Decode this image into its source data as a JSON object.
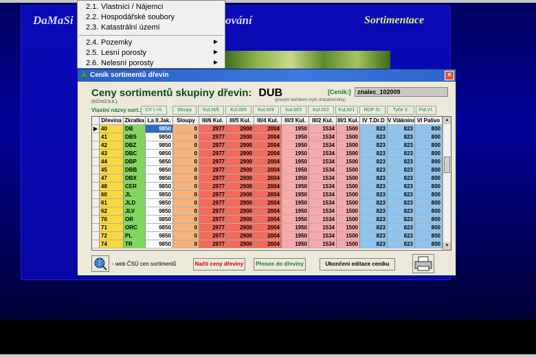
{
  "app": {
    "title": "DaMaSi",
    "title2": "ování",
    "section": "Sortimentace"
  },
  "menu": {
    "items": [
      {
        "num": "2.1.",
        "label": "Vlastníci / Nájemci",
        "submenu": false
      },
      {
        "num": "2.2.",
        "label": "Hospodářské soubory",
        "submenu": false
      },
      {
        "num": "2.3.",
        "label": "Katastrální území",
        "submenu": false
      },
      {
        "num": "2.4.",
        "label": "Pozemky",
        "submenu": true
      },
      {
        "num": "2.5.",
        "label": "Lesní porosty",
        "submenu": true
      },
      {
        "num": "2.6.",
        "label": "Nelesní porosty",
        "submenu": true
      }
    ]
  },
  "dialog": {
    "title": "Ceník sortimentů dřevin",
    "heading": "Ceny sortimentů skupiny dřevin:",
    "group_code": "DUB",
    "unit_note": "(Kč/m3 b.k.)",
    "hint": "(pravým tlačítkem myši charakteristiky)",
    "cenik_label": "[Cenik:]",
    "cenik_value": "znalec_102009",
    "names_label": "Vlastní názvy sort.:",
    "column_name_buttons": [
      "CV I.+II.",
      "Sloupy",
      "Kul.III/6",
      "Kul.III/5",
      "Kul.III/4",
      "Kul.III/3",
      "Kul.III/2",
      "Kul.III/1",
      "RDP IV.",
      "Tyče V.",
      "Pal.VI."
    ],
    "columns": [
      "",
      "Dřevina",
      "Zkratka",
      "La II.Jak.",
      "Sloupy",
      "III/6 Kul.",
      "III/5 Kul.",
      "III/4 Kul.",
      "III/3 Kul.",
      "III/2 Kul.",
      "III/1 Kul.",
      "IV T.Dr.D",
      "V Vláknina",
      "VI Palivo"
    ],
    "rows": [
      [
        "▶",
        "40",
        "DB",
        "9850",
        "0",
        "2977",
        "2900",
        "2004",
        "1950",
        "1534",
        "1500",
        "823",
        "823",
        "800"
      ],
      [
        "",
        "41",
        "DBS",
        "9850",
        "0",
        "2977",
        "2900",
        "2004",
        "1950",
        "1534",
        "1500",
        "823",
        "823",
        "800"
      ],
      [
        "",
        "42",
        "DBZ",
        "9850",
        "0",
        "2977",
        "2900",
        "2004",
        "1950",
        "1534",
        "1500",
        "823",
        "823",
        "800"
      ],
      [
        "",
        "43",
        "DBC",
        "9850",
        "0",
        "2977",
        "2900",
        "2004",
        "1950",
        "1534",
        "1500",
        "823",
        "823",
        "800"
      ],
      [
        "",
        "44",
        "DBP",
        "9850",
        "0",
        "2977",
        "2900",
        "2004",
        "1950",
        "1534",
        "1500",
        "823",
        "823",
        "800"
      ],
      [
        "",
        "45",
        "DBB",
        "9850",
        "0",
        "2977",
        "2900",
        "2004",
        "1950",
        "1534",
        "1500",
        "823",
        "823",
        "800"
      ],
      [
        "",
        "47",
        "DBX",
        "9850",
        "0",
        "2977",
        "2900",
        "2004",
        "1950",
        "1534",
        "1500",
        "823",
        "823",
        "800"
      ],
      [
        "",
        "48",
        "CER",
        "9850",
        "0",
        "2977",
        "2900",
        "2004",
        "1950",
        "1534",
        "1500",
        "823",
        "823",
        "800"
      ],
      [
        "",
        "60",
        "JL",
        "9850",
        "0",
        "2977",
        "2900",
        "2004",
        "1950",
        "1534",
        "1500",
        "823",
        "823",
        "800"
      ],
      [
        "",
        "61",
        "JLD",
        "9850",
        "0",
        "2977",
        "2900",
        "2004",
        "1950",
        "1534",
        "1500",
        "823",
        "823",
        "800"
      ],
      [
        "",
        "62",
        "JLV",
        "9850",
        "0",
        "2977",
        "2900",
        "2004",
        "1950",
        "1534",
        "1500",
        "823",
        "823",
        "800"
      ],
      [
        "",
        "70",
        "OR",
        "9850",
        "0",
        "2977",
        "2900",
        "2004",
        "1950",
        "1534",
        "1500",
        "823",
        "823",
        "800"
      ],
      [
        "",
        "71",
        "ORC",
        "9850",
        "0",
        "2977",
        "2900",
        "2004",
        "1950",
        "1534",
        "1500",
        "823",
        "823",
        "800"
      ],
      [
        "",
        "72",
        "PL",
        "9850",
        "0",
        "2977",
        "2900",
        "2004",
        "1950",
        "1534",
        "1500",
        "823",
        "823",
        "800"
      ],
      [
        "",
        "74",
        "TR",
        "9850",
        "0",
        "2977",
        "2900",
        "2004",
        "1950",
        "1534",
        "1500",
        "823",
        "823",
        "800"
      ]
    ],
    "web_label": "- web ČSÚ cen sortimentů",
    "btn_load": "Načti ceny dřeviny",
    "btn_transfer": "Přenos do dřeviny",
    "btn_finish": "Ukončení editace ceníku",
    "close_symbol": "×",
    "icons": {
      "web": "globe-search-icon",
      "print": "printer-icon",
      "close": "close-icon"
    }
  },
  "colors": {
    "col_id": "#f7d93e",
    "col_code": "#7ed957",
    "col_la": "#ffffff",
    "col_la_selected": "#316ac5",
    "col_sloupy": "#f5b27a",
    "col_red": "#f26b5b",
    "col_pink": "#f7a9a9",
    "col_blue": "#8ec5f0"
  }
}
